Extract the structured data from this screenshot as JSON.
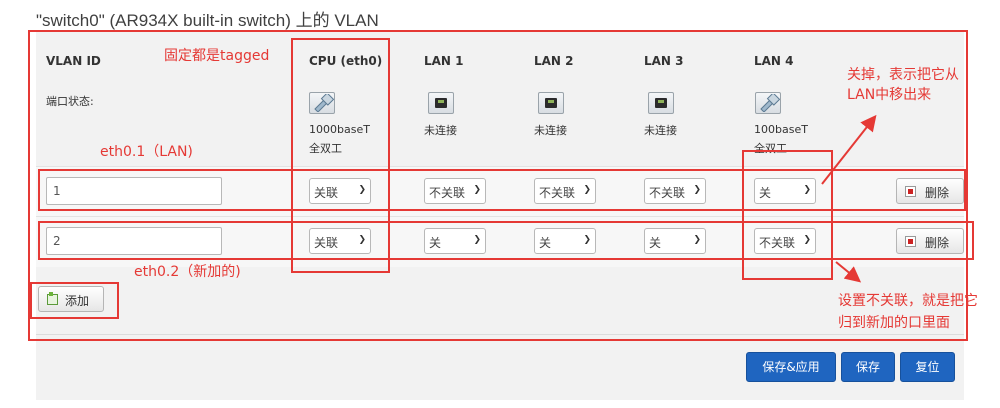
{
  "page_title": "\"switch0\" (AR934X built-in switch) 上的 VLAN",
  "columns": {
    "vlan_id": "VLAN ID",
    "cpu": "CPU (eth0)",
    "lan1": "LAN 1",
    "lan2": "LAN 2",
    "lan3": "LAN 3",
    "lan4": "LAN 4"
  },
  "port_status": {
    "label": "端口状态:",
    "cpu": {
      "line1": "1000baseT",
      "line2": "全双工",
      "icon": "ethernet-plugged-icon"
    },
    "lan1": {
      "line1": "未连接",
      "icon": "ethernet-port-icon"
    },
    "lan2": {
      "line1": "未连接",
      "icon": "ethernet-port-icon"
    },
    "lan3": {
      "line1": "未连接",
      "icon": "ethernet-port-icon"
    },
    "lan4": {
      "line1": "100baseT",
      "line2": "全双工",
      "icon": "ethernet-plugged-icon"
    }
  },
  "rows": [
    {
      "vlan_id": "1",
      "cpu": "关联",
      "lan1": "不关联",
      "lan2": "不关联",
      "lan3": "不关联",
      "lan4": "关",
      "delete_label": "删除"
    },
    {
      "vlan_id": "2",
      "cpu": "关联",
      "lan1": "关",
      "lan2": "关",
      "lan3": "关",
      "lan4": "不关联",
      "delete_label": "删除"
    }
  ],
  "add_label": "添加",
  "footer": {
    "save_apply": "保存&应用",
    "save": "保存",
    "reset": "复位"
  },
  "annotations": {
    "tagged_note": "固定都是tagged",
    "eth01": "eth0.1（LAN)",
    "eth02": "eth0.2（新加的)",
    "lan4_off_line1": "关掉，表示把它从",
    "lan4_off_line2": "LAN中移出来",
    "not_assoc_line1": "设置不关联，就是把它",
    "not_assoc_line2": "归到新加的口里面"
  },
  "colors": {
    "annotation_red": "#e53935",
    "primary_button": "#1f65c0"
  }
}
